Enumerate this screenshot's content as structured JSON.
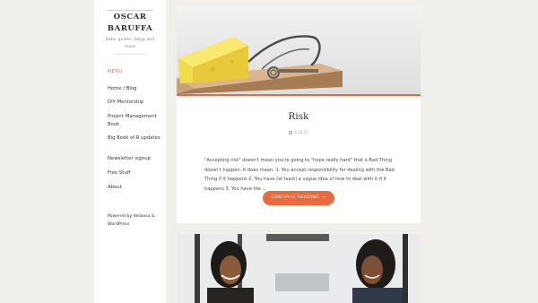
{
  "site": {
    "title": "OSCAR BARUFFA",
    "tagline": "Data, guides, blogs and more"
  },
  "menu": {
    "heading": "MENU",
    "items": [
      {
        "label": "Home / Blog"
      },
      {
        "label": "DIY Mentorship"
      },
      {
        "label": "Project Management Book"
      },
      {
        "label": "Big Book of R updates"
      },
      {
        "label": "Newsletter signup"
      },
      {
        "label": "Free Stuff"
      },
      {
        "label": "About"
      }
    ]
  },
  "footer": {
    "powered": "Powered by Verbosa & WordPress"
  },
  "post": {
    "title": "Risk",
    "date": "6.10.21",
    "excerpt": "\"Accepting risk\" doesn't mean you're going to \"hope really hard\" that a Bad Thing doesn't happen. It does mean: 1. You accept responsibility for dealing with the Bad Thing if it happens 2. You have (at least) a vague idea of how to deal with it if it happens 3. You have the …",
    "continue_label": "CONTINUE READING",
    "continue_arrow": "→"
  },
  "colors": {
    "accent": "#e86a3e",
    "background": "#f1efec"
  }
}
